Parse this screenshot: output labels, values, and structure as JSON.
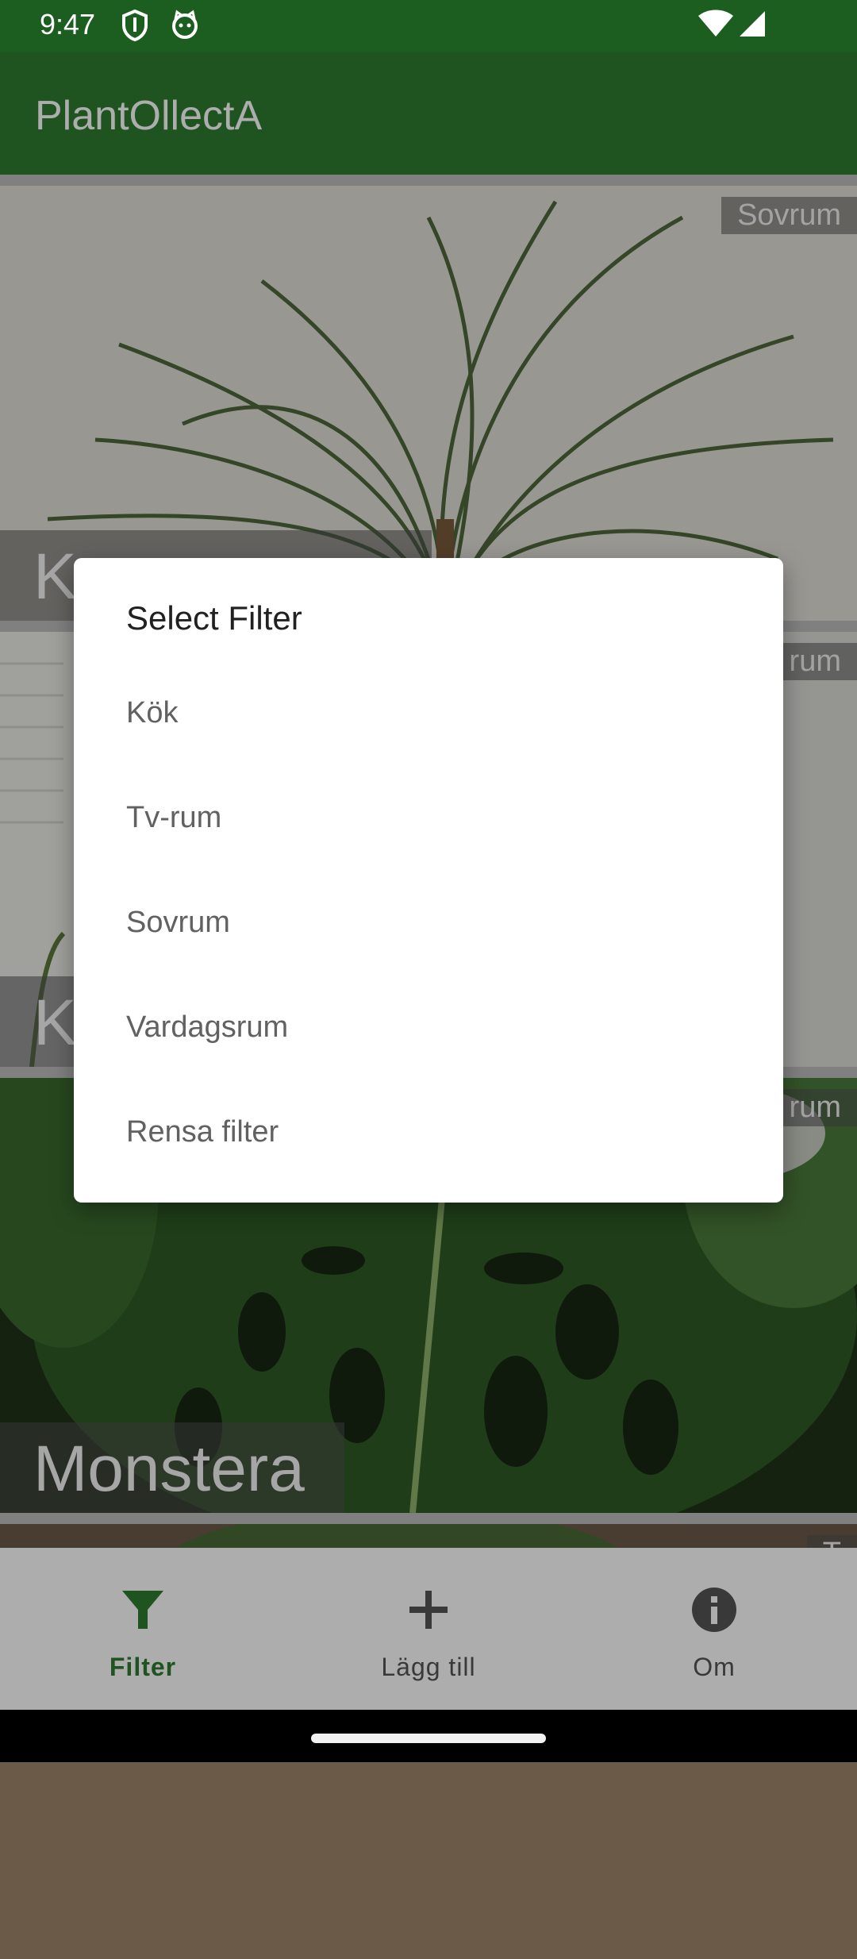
{
  "status_bar": {
    "time": "9:47",
    "icons": [
      "shield-icon",
      "cat-face-icon",
      "wifi-icon",
      "cellular-signal-icon"
    ]
  },
  "app_bar": {
    "title": "PlantOllectA"
  },
  "colors": {
    "primary": "#2e7d32",
    "primary_dark": "#1b5e20",
    "scrim": "#000000"
  },
  "plant_cards": [
    {
      "name": "K",
      "room": "Sovrum",
      "photo": "dracaena-photo"
    },
    {
      "name": "K",
      "room": "rum",
      "photo": "window-plant-photo"
    },
    {
      "name": "Monstera",
      "room": "rum",
      "photo": "monstera-photo"
    },
    {
      "name": "",
      "room": "T",
      "photo": "plant-photo"
    }
  ],
  "dialog": {
    "title": "Select Filter",
    "options": [
      "Kök",
      "Tv-rum",
      "Sovrum",
      "Vardagsrum",
      "Rensa filter"
    ]
  },
  "bottom_nav": {
    "items": [
      {
        "label": "Filter",
        "icon": "filter-icon",
        "active": true
      },
      {
        "label": "Lägg till",
        "icon": "plus-icon",
        "active": false
      },
      {
        "label": "Om",
        "icon": "info-icon",
        "active": false
      }
    ]
  }
}
